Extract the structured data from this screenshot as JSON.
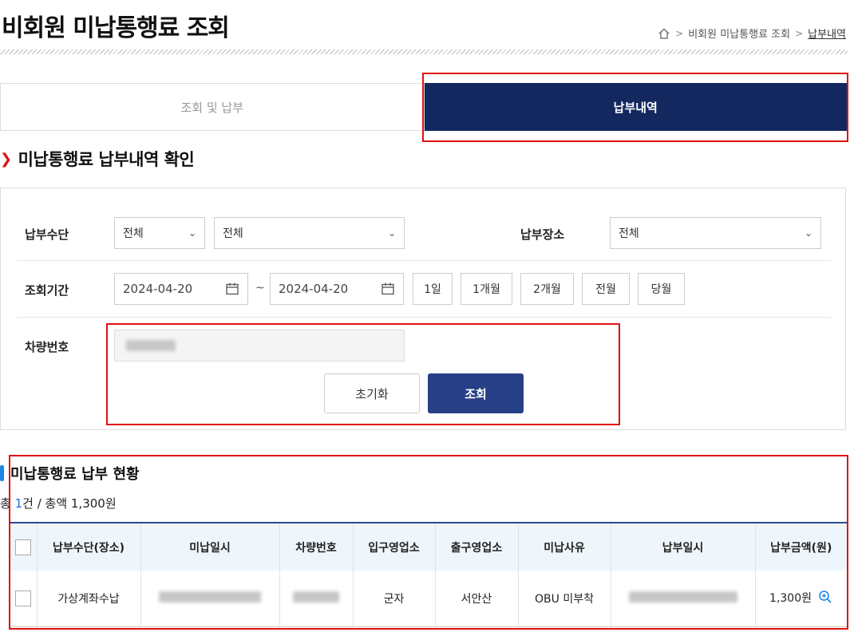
{
  "page": {
    "title": "비회원 미납통행료 조회"
  },
  "breadcrumb": {
    "home_icon": "home-icon",
    "items": [
      "비회원 미납통행료 조회",
      "납부내역"
    ]
  },
  "tabs": [
    {
      "label": "조회 및 납부",
      "active": false
    },
    {
      "label": "납부내역",
      "active": true
    }
  ],
  "section": {
    "title": "미납통행료 납부내역 확인"
  },
  "filters": {
    "payment_method": {
      "label": "납부수단",
      "select1": "전체",
      "select2": "전체"
    },
    "payment_place": {
      "label": "납부장소",
      "select": "전체"
    },
    "period": {
      "label": "조회기간",
      "from": "2024-04-20",
      "tilde": "~",
      "to": "2024-04-20",
      "quick": [
        "1일",
        "1개월",
        "2개월",
        "전월",
        "당월"
      ]
    },
    "plate": {
      "label": "차량번호"
    },
    "reset_label": "초기화",
    "search_label": "조회"
  },
  "status": {
    "title": "미납통행료 납부 현황",
    "summary_prefix": "총 ",
    "count": "1",
    "summary_suffix": "건 / 총액 1,300원"
  },
  "table": {
    "headers": [
      "",
      "납부수단(장소)",
      "미납일시",
      "차량번호",
      "입구영업소",
      "출구영업소",
      "미납사유",
      "납부일시",
      "납부금액(원)"
    ],
    "rows": [
      {
        "method": "가상계좌수납",
        "entry": "군자",
        "exit": "서안산",
        "reason": "OBU 미부착",
        "amount": "1,300원"
      }
    ]
  },
  "colors": {
    "navy_tab": "#13285f",
    "search_button": "#263f86",
    "highlight_red": "#e01010",
    "accent_blue": "#1e88e5"
  }
}
